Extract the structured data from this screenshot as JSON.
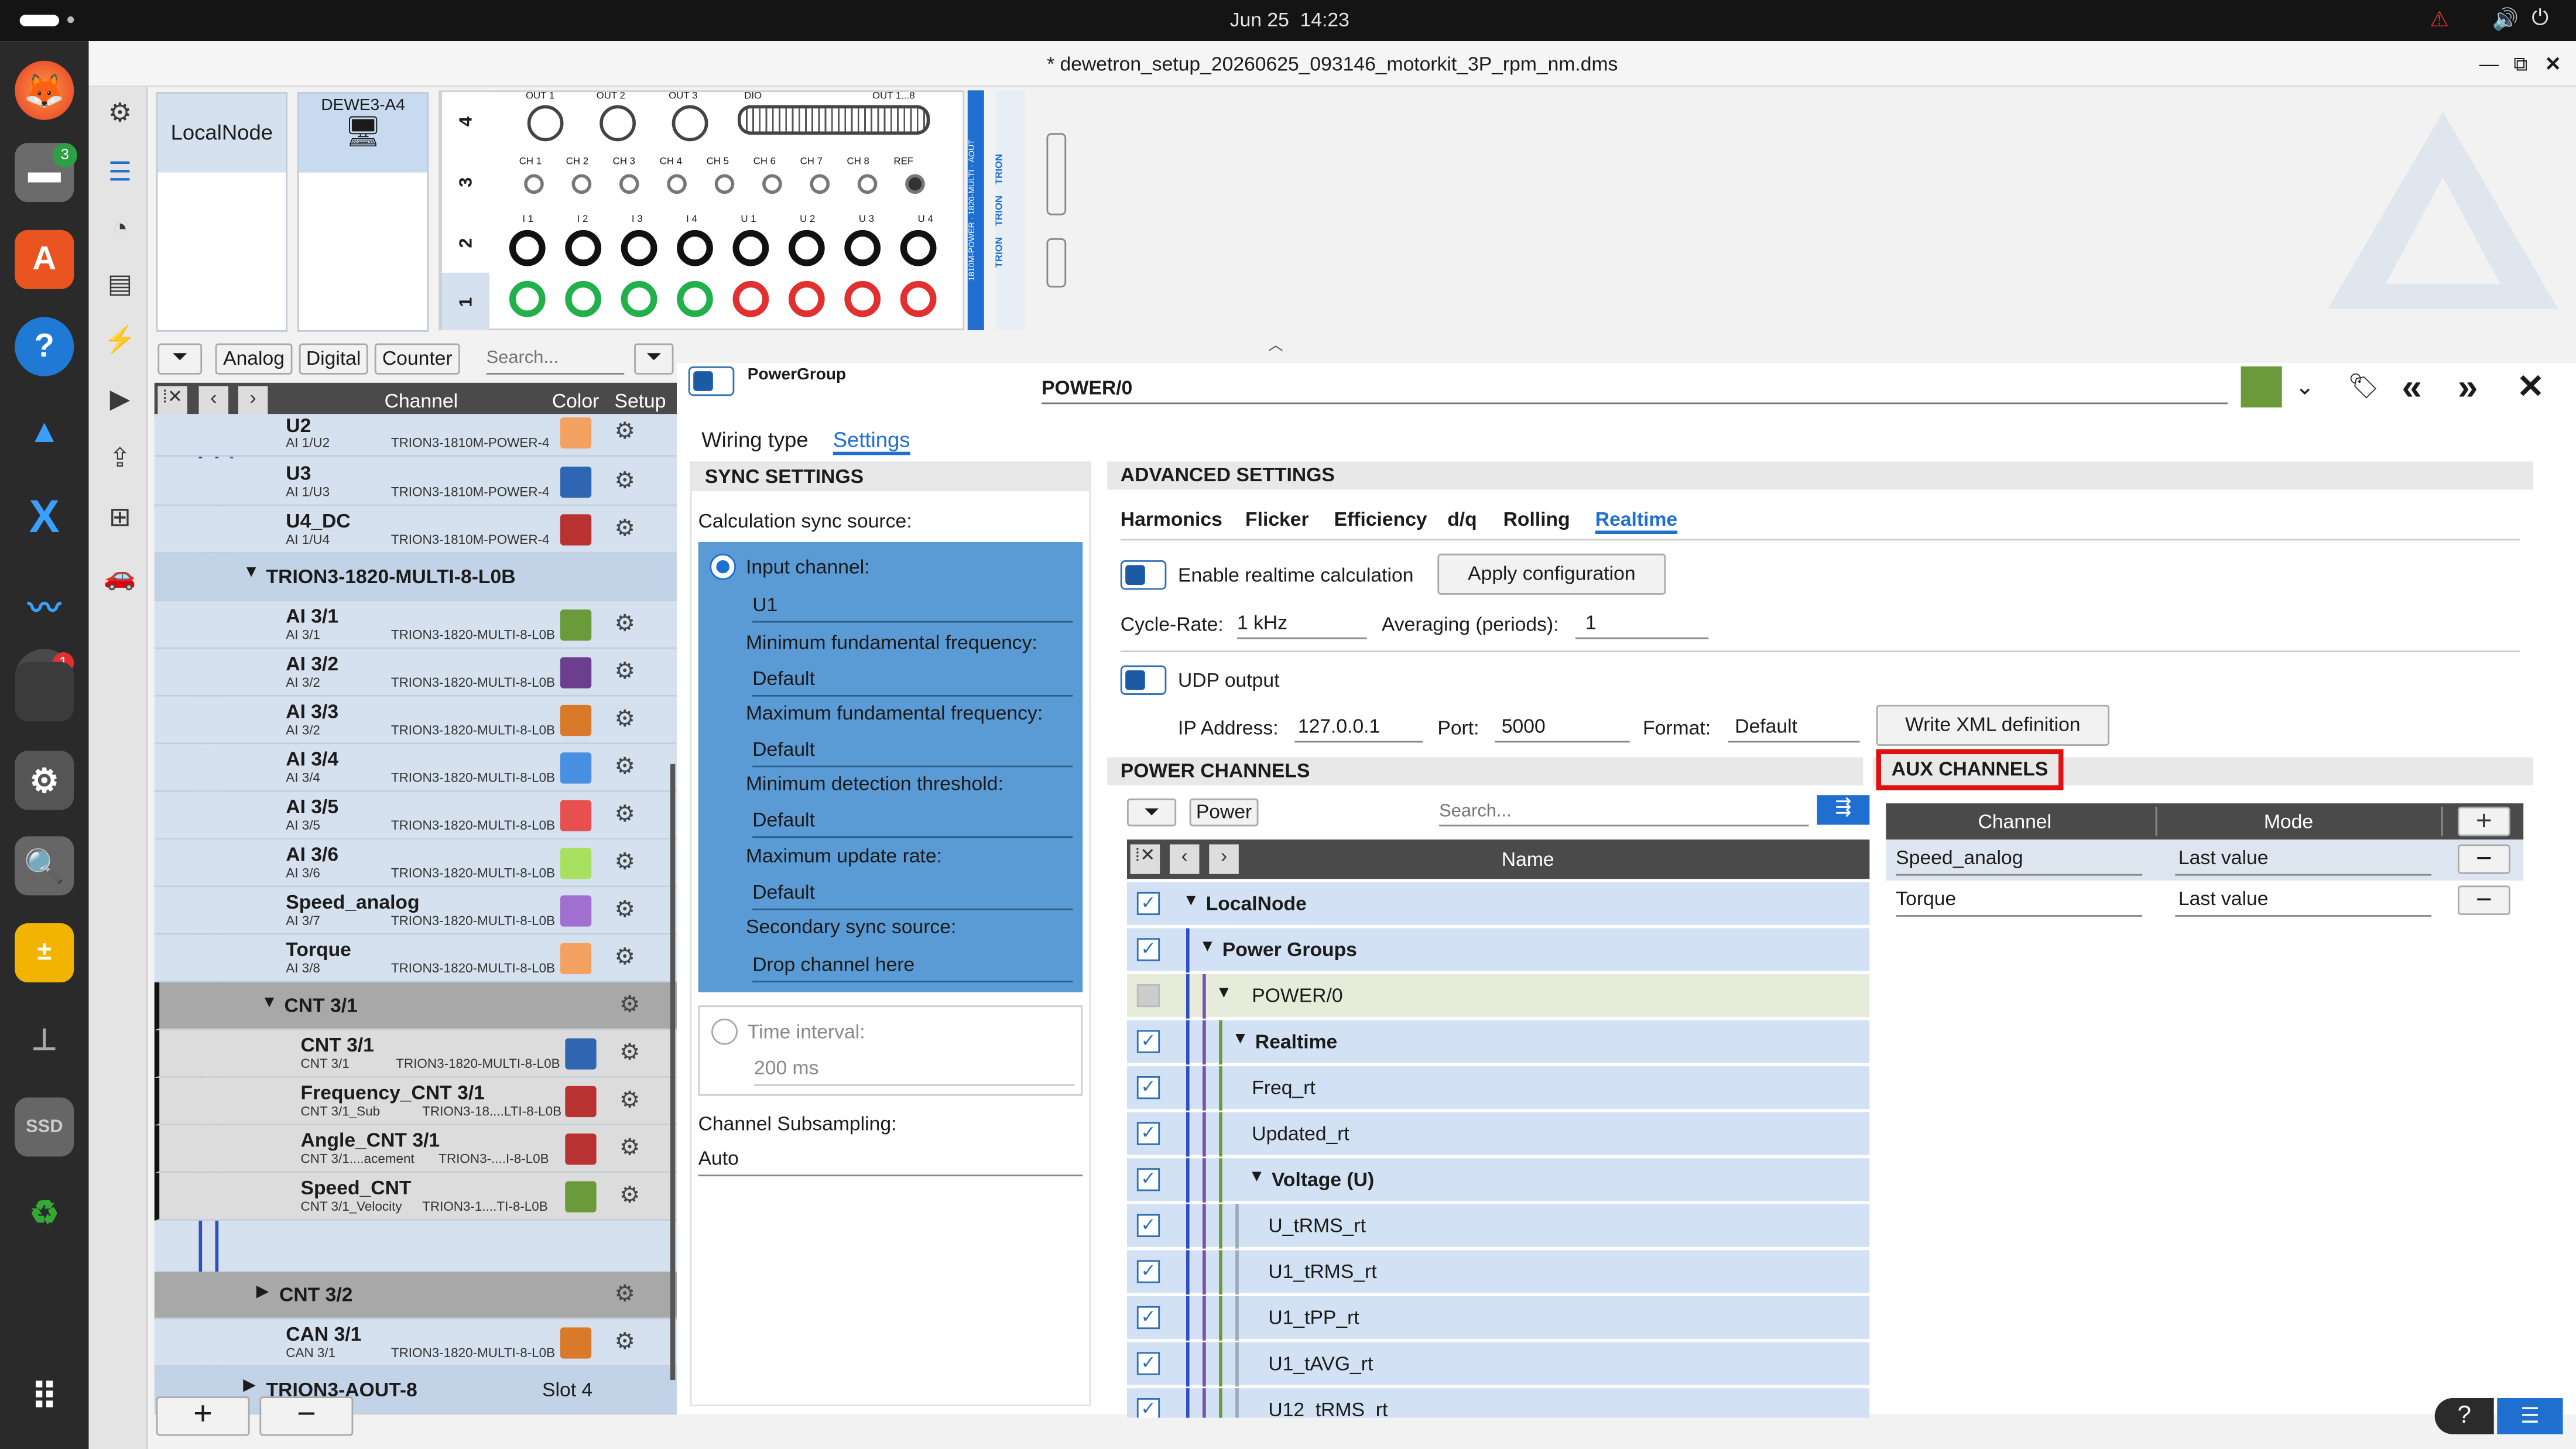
{
  "system": {
    "date": "Jun 25",
    "time": "14:23"
  },
  "window": {
    "title": "* dewetron_setup_20260625_093146_motorkit_3P_rpm_nm.dms"
  },
  "dock": {
    "badge_files": "3",
    "badge_app": "1",
    "ssd_label": "SSD"
  },
  "nodes": {
    "local": "LocalNode",
    "device": "DEWE3-A4"
  },
  "hardware": {
    "slots": [
      "4",
      "3",
      "2",
      "1"
    ],
    "out_labels": [
      "OUT 1",
      "OUT 2",
      "OUT 3",
      "DIO",
      "OUT 1...8"
    ],
    "ch_labels": [
      "CH 1",
      "CH 2",
      "CH 3",
      "CH 4",
      "CH 5",
      "CH 6",
      "CH 7",
      "CH 8",
      "REF"
    ],
    "power_labels": [
      "I 1",
      "I 2",
      "I 3",
      "I 4",
      "U 1",
      "U 2",
      "U 3",
      "U 4"
    ],
    "side_modules": [
      "AOUT",
      "1820-MULTI",
      "1810M-POWER"
    ],
    "trion_labels": [
      "TRION",
      "TRION",
      "TRION"
    ]
  },
  "filters": {
    "analog": "Analog",
    "digital": "Digital",
    "counter": "Counter",
    "search_placeholder": "Search..."
  },
  "channel_list": {
    "header_channel": "Channel",
    "header_color": "Color",
    "header_setup": "Setup",
    "rows": [
      {
        "name": "U2",
        "sub": "AI 1/U2",
        "mod": "TRION3-1810M-POWER-4",
        "color": "#f4a261"
      },
      {
        "name": "U3",
        "sub": "AI 1/U3",
        "mod": "TRION3-1810M-POWER-4",
        "color": "#2f66b3"
      },
      {
        "name": "U4_DC",
        "sub": "AI 1/U4",
        "mod": "TRION3-1810M-POWER-4",
        "color": "#b83232"
      },
      {
        "name": "AI 3/1",
        "sub": "AI 3/1",
        "mod": "TRION3-1820-MULTI-8-L0B",
        "color": "#6a9a3a"
      },
      {
        "name": "AI 3/2",
        "sub": "AI 3/2",
        "mod": "TRION3-1820-MULTI-8-L0B",
        "color": "#6c3f8e"
      },
      {
        "name": "AI 3/3",
        "sub": "AI 3/2",
        "mod": "TRION3-1820-MULTI-8-L0B",
        "color": "#d97a2a"
      },
      {
        "name": "AI 3/4",
        "sub": "AI 3/4",
        "mod": "TRION3-1820-MULTI-8-L0B",
        "color": "#4a90e2"
      },
      {
        "name": "AI 3/5",
        "sub": "AI 3/5",
        "mod": "TRION3-1820-MULTI-8-L0B",
        "color": "#e85050"
      },
      {
        "name": "AI 3/6",
        "sub": "AI 3/6",
        "mod": "TRION3-1820-MULTI-8-L0B",
        "color": "#a8e060"
      },
      {
        "name": "Speed_analog",
        "sub": "AI 3/7",
        "mod": "TRION3-1820-MULTI-8-L0B",
        "color": "#a070d0"
      },
      {
        "name": "Torque",
        "sub": "AI 3/8",
        "mod": "TRION3-1820-MULTI-8-L0B",
        "color": "#f4a261"
      },
      {
        "name": "CNT 3/1",
        "sub": "CNT 3/1",
        "mod": "TRION3-1820-MULTI-8-L0B",
        "color": "#2f66b3"
      },
      {
        "name": "Frequency_CNT 3/1",
        "sub": "CNT 3/1_Sub",
        "mod": "TRION3-18....LTI-8-L0B",
        "color": "#b83232"
      },
      {
        "name": "Angle_CNT 3/1",
        "sub": "CNT 3/1....acement",
        "mod": "TRION3-....I-8-L0B",
        "color": "#b83232"
      },
      {
        "name": "Speed_CNT",
        "sub": "CNT 3/1_Velocity",
        "mod": "TRION3-1....TI-8-L0B",
        "color": "#6a9a3a"
      },
      {
        "name": "CAN 3/1",
        "sub": "CAN 3/1",
        "mod": "TRION3-1820-MULTI-8-L0B",
        "color": "#d97a2a"
      }
    ],
    "group_multi": "TRION3-1820-MULTI-8-L0B",
    "group_cnt31": "CNT 3/1",
    "group_cnt32": "CNT 3/2",
    "group_aout": "TRION3-AOUT-8",
    "group_aout_slot": "Slot 4"
  },
  "details": {
    "group_label": "PowerGroup",
    "channel_name": "POWER/0",
    "group_color": "#6a9a3a",
    "tabs": [
      "Wiring type",
      "Settings"
    ],
    "active_tab": "Settings"
  },
  "sync": {
    "title": "SYNC SETTINGS",
    "calc_source_label": "Calculation sync source:",
    "input_channel_label": "Input channel:",
    "input_channel_value": "U1",
    "min_freq_label": "Minimum fundamental frequency:",
    "min_freq_value": "Default",
    "max_freq_label": "Maximum fundamental frequency:",
    "max_freq_value": "Default",
    "min_thresh_label": "Minimum detection threshold:",
    "min_thresh_value": "Default",
    "max_rate_label": "Maximum update rate:",
    "max_rate_value": "Default",
    "secondary_label": "Secondary sync source:",
    "secondary_value": "Drop channel here",
    "time_interval_label": "Time interval:",
    "time_interval_value": "200 ms",
    "subsampling_label": "Channel Subsampling:",
    "subsampling_value": "Auto"
  },
  "advanced": {
    "title": "ADVANCED SETTINGS",
    "tabs": [
      "Harmonics",
      "Flicker",
      "Efficiency",
      "d/q",
      "Rolling",
      "Realtime"
    ],
    "active_tab": "Realtime",
    "enable_label": "Enable realtime calculation",
    "apply_button": "Apply configuration",
    "cycle_rate_label": "Cycle-Rate:",
    "cycle_rate_value": "1 kHz",
    "averaging_label": "Averaging (periods):",
    "averaging_value": "1",
    "udp_label": "UDP output",
    "ip_label": "IP Address:",
    "ip_value": "127.0.0.1",
    "port_label": "Port:",
    "port_value": "5000",
    "format_label": "Format:",
    "format_value": "Default",
    "xml_button": "Write XML definition"
  },
  "power_channels": {
    "title": "POWER CHANNELS",
    "filter_label": "Power",
    "search_placeholder": "Search...",
    "name_header": "Name",
    "rows": [
      {
        "label": "LocalNode",
        "checked": true
      },
      {
        "label": "Power Groups",
        "checked": true
      },
      {
        "label": "POWER/0",
        "checked": false
      },
      {
        "label": "Realtime",
        "checked": true
      },
      {
        "label": "Freq_rt",
        "checked": true
      },
      {
        "label": "Updated_rt",
        "checked": true
      },
      {
        "label": "Voltage (U)",
        "checked": true
      },
      {
        "label": "U_tRMS_rt",
        "checked": true
      },
      {
        "label": "U1_tRMS_rt",
        "checked": true
      },
      {
        "label": "U1_tPP_rt",
        "checked": true
      },
      {
        "label": "U1_tAVG_rt",
        "checked": true
      },
      {
        "label": "U12_tRMS_rt",
        "checked": true
      }
    ]
  },
  "aux_channels": {
    "title": "AUX CHANNELS",
    "header_channel": "Channel",
    "header_mode": "Mode",
    "rows": [
      {
        "channel": "Speed_analog",
        "mode": "Last value"
      },
      {
        "channel": "Torque",
        "mode": "Last value"
      }
    ]
  }
}
